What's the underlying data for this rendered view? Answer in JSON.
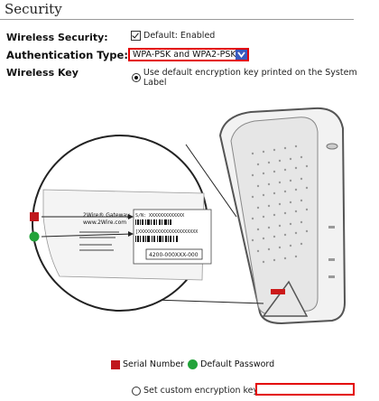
{
  "section": {
    "title": "Security"
  },
  "wireless_security": {
    "label": "Wireless Security:",
    "checkbox_label": "Default: Enabled",
    "checked": true
  },
  "authentication": {
    "label": "Authentication Type:",
    "selected": "WPA-PSK and WPA2-PSK"
  },
  "wireless_key": {
    "label": "Wireless Key",
    "option_default": "Use default encryption key printed on the System Label",
    "option_custom": "Set custom encryption key",
    "custom_value": ""
  },
  "label_sticker": {
    "brand_line1": "2Wire® Gateway",
    "brand_line2": "www.2Wire.com",
    "sn_text": "S/N: XXXXXXXXXXXXX",
    "key_text": "[XXXXXXXXXXXXXXXXXXXXXX",
    "code_text": "4200-000XXX-000"
  },
  "legend": {
    "serial_number": "Serial Number",
    "default_password": "Default Password"
  },
  "colors": {
    "accent_red": "#e30000",
    "serial_marker": "#c0171c",
    "password_marker": "#22a33a",
    "select_arrow": "#3a5bbf"
  },
  "icons": [
    "checkbox-checked-icon",
    "chevron-down-icon",
    "radio-selected-icon",
    "radio-empty-icon"
  ]
}
